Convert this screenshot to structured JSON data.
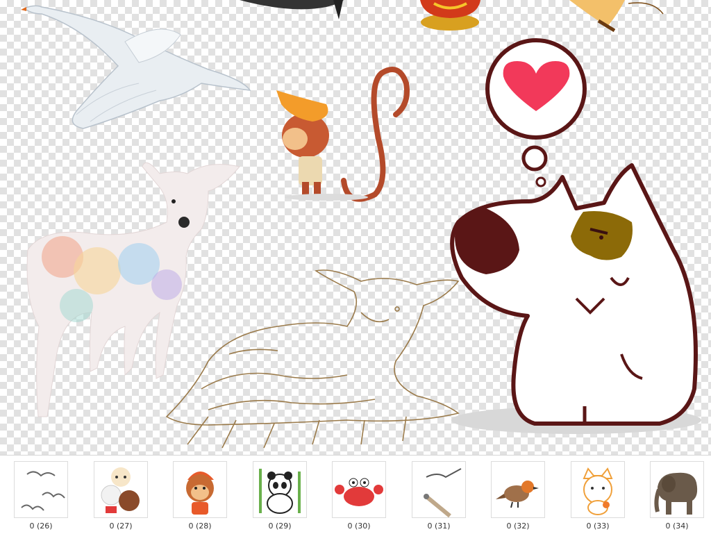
{
  "thumbnails": [
    {
      "label": "0 (26)",
      "icon": "flying-birds-icon"
    },
    {
      "label": "0 (27)",
      "icon": "cartoon-cats-icon"
    },
    {
      "label": "0 (28)",
      "icon": "cartoon-monkey-icon"
    },
    {
      "label": "0 (29)",
      "icon": "panda-icon"
    },
    {
      "label": "0 (30)",
      "icon": "crab-icon"
    },
    {
      "label": "0 (31)",
      "icon": "seagulls-icon"
    },
    {
      "label": "0 (32)",
      "icon": "robin-bird-icon"
    },
    {
      "label": "0 (33)",
      "icon": "cute-cat-icon"
    },
    {
      "label": "0 (34)",
      "icon": "elephant-icon"
    }
  ],
  "colors": {
    "checker": "#e1e1e1",
    "heart": "#f2395a",
    "dog-outline": "#5a1616",
    "dog-patch": "#8c6a08",
    "monkey": "#b44a2a",
    "sheep-sketch": "#9a7a4a"
  }
}
